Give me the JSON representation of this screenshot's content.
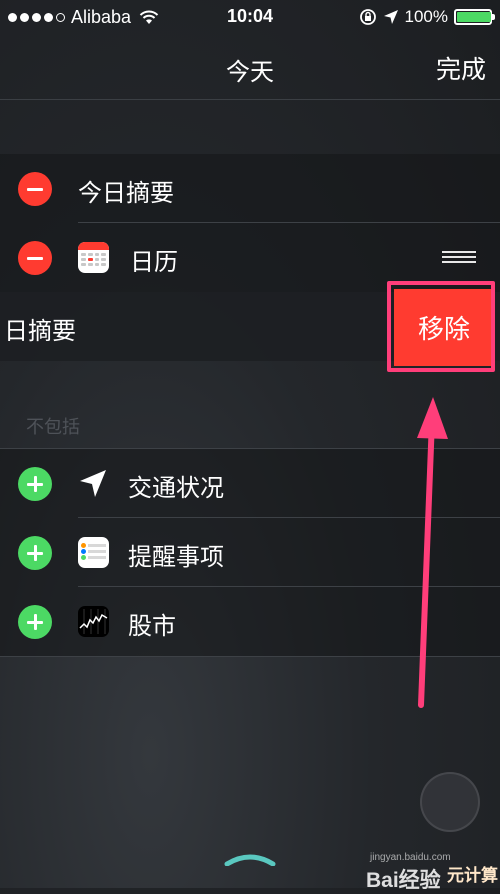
{
  "status_bar": {
    "carrier": "Alibaba",
    "time": "10:04",
    "battery_text": "100%",
    "battery_level": 1.0,
    "icons": [
      "signal-dots",
      "wifi-icon",
      "rotation-lock-icon",
      "location-arrow-icon",
      "battery-icon"
    ]
  },
  "nav": {
    "title": "今天",
    "done_label": "完成"
  },
  "included": [
    {
      "label": "今日摘要",
      "icon": "none"
    },
    {
      "label": "日历",
      "icon": "calendar-icon"
    }
  ],
  "swiped_row": {
    "label": "日摘要",
    "remove_label": "移除"
  },
  "excluded_header": "不包括",
  "excluded": [
    {
      "label": "交通状况",
      "icon": "location-arrow-icon"
    },
    {
      "label": "提醒事项",
      "icon": "reminders-icon"
    },
    {
      "label": "股市",
      "icon": "stocks-icon"
    }
  ],
  "watermark": {
    "main": "Bai经验",
    "sub": "jingyan.baidu.com",
    "corner": "元计算"
  },
  "colors": {
    "delete": "#ff3b30",
    "add": "#4cd964",
    "annotation": "#ff3e7a",
    "background": "#24272b"
  }
}
